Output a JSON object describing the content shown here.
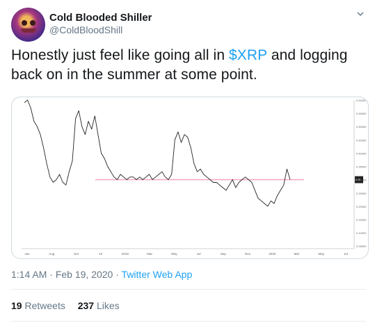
{
  "tweet": {
    "author_name": "Cold Blooded Shiller",
    "author_handle": "@ColdBloodShill",
    "text_before": "Honestly just feel like going all in ",
    "cashtag": "$XRP",
    "text_after": " and logging back on in the summer at some point.",
    "time": "1:14 AM",
    "separator": " · ",
    "date": "Feb 19, 2020",
    "app": "Twitter Web App",
    "retweets_count": "19",
    "retweets_label": "Retweets",
    "likes_count": "237",
    "likes_label": "Likes"
  },
  "colors": {
    "link": "#1da1f2",
    "muted": "#657786",
    "support_line": "#f4a7bd"
  },
  "chart_data": {
    "type": "line",
    "x_tick_labels": [
      "Jun",
      "Aug",
      "Oct",
      "12",
      "2019",
      "Mar",
      "May",
      "Jul",
      "Sep",
      "Nov",
      "2020",
      "Mar",
      "May",
      "Jul"
    ],
    "y_tick_labels": [
      "0.60000",
      "0.55000",
      "0.50000",
      "0.45000",
      "0.40000",
      "0.35000",
      "0.30000",
      "0.25000",
      "0.20000",
      "0.15000",
      "0.10000",
      "0.05000"
    ],
    "price_label": "0.29...",
    "ylim": [
      0.04,
      0.6
    ],
    "support_level": 0.3,
    "values": [
      0.59,
      0.6,
      0.57,
      0.52,
      0.5,
      0.47,
      0.42,
      0.36,
      0.31,
      0.29,
      0.3,
      0.32,
      0.29,
      0.28,
      0.33,
      0.37,
      0.53,
      0.56,
      0.5,
      0.47,
      0.52,
      0.49,
      0.54,
      0.47,
      0.4,
      0.38,
      0.35,
      0.33,
      0.31,
      0.3,
      0.32,
      0.31,
      0.3,
      0.31,
      0.31,
      0.3,
      0.31,
      0.3,
      0.31,
      0.32,
      0.3,
      0.31,
      0.32,
      0.33,
      0.31,
      0.3,
      0.32,
      0.45,
      0.48,
      0.44,
      0.47,
      0.46,
      0.42,
      0.36,
      0.33,
      0.34,
      0.32,
      0.31,
      0.3,
      0.29,
      0.29,
      0.28,
      0.27,
      0.26,
      0.28,
      0.3,
      0.27,
      0.29,
      0.3,
      0.31,
      0.3,
      0.29,
      0.26,
      0.23,
      0.22,
      0.21,
      0.2,
      0.22,
      0.21,
      0.24,
      0.26,
      0.28,
      0.34,
      0.3
    ]
  }
}
